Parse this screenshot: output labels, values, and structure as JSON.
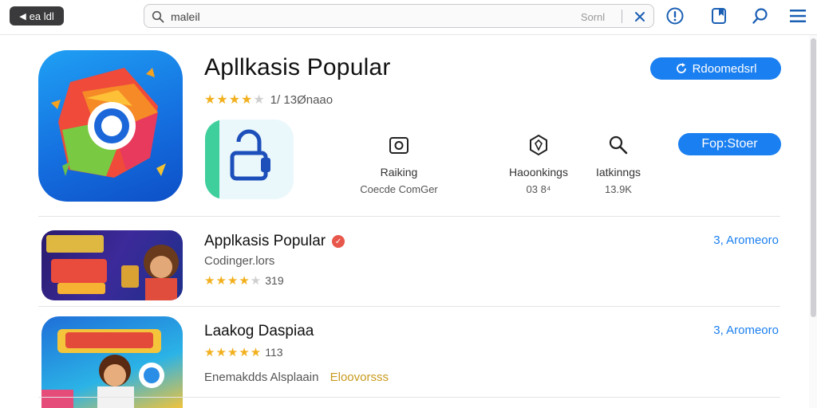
{
  "topbar": {
    "back_label": "ea ldl",
    "search_value": "maleil",
    "search_hint": "Sornl"
  },
  "featured": {
    "title": "Apllkasis Popular",
    "stars": 4,
    "rating_count": "1/ 13Ønaao",
    "download_label": "Rdoomedsrl",
    "pop_store_label": "Fop:Stoer",
    "stats": [
      {
        "icon": "camera-icon",
        "label": "Raiking",
        "value": "Coecde ComGer"
      },
      {
        "icon": "badge-icon",
        "label": "Haoonkings",
        "value": "03 8⁴"
      },
      {
        "icon": "search-icon",
        "label": "Iatkinngs",
        "value": "13.9K"
      }
    ]
  },
  "list": [
    {
      "title": "Applkasis Popular",
      "verified": true,
      "subtitle": "Codinger.lors",
      "stars": 4.5,
      "rating": "319",
      "link": "3, Aromeoro"
    },
    {
      "title": "Laakog Daspiaa",
      "verified": false,
      "subtitle": "",
      "stars": 5,
      "rating": "113",
      "link": "3, Aromeoro",
      "desc": "Enemakdds Alsplaain",
      "tag": "Eloovorsss"
    }
  ],
  "colors": {
    "accent": "#1a7ff0",
    "star": "#f2b01e",
    "verified": "#e8574b"
  }
}
